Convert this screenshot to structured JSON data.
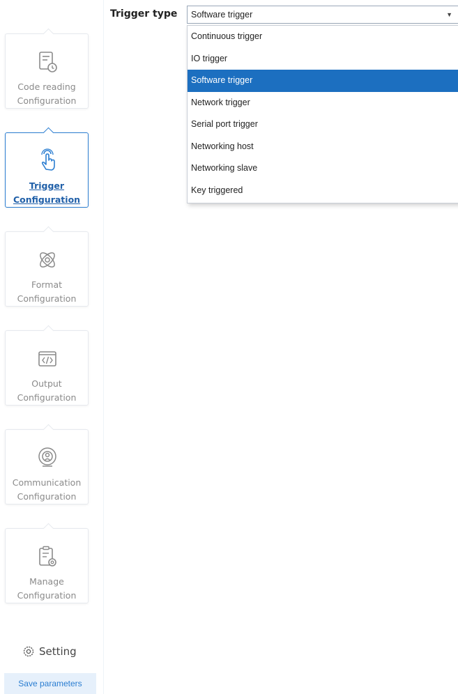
{
  "header": {
    "trigger_type_label": "Trigger type",
    "trigger_select_value": "Software trigger"
  },
  "dropdown": {
    "options": [
      "Continuous trigger",
      "IO trigger",
      "Software trigger",
      "Network trigger",
      "Serial port trigger",
      "Networking host",
      "Networking slave",
      "Key triggered"
    ],
    "selected": "Software trigger"
  },
  "sidebar": {
    "items": [
      {
        "line1": "Code reading",
        "line2": "Configuration",
        "icon": "code-reading-icon",
        "active": false
      },
      {
        "line1": "Trigger",
        "line2": "Configuration",
        "icon": "hand-tap-icon",
        "active": true
      },
      {
        "line1": "Format",
        "line2": "Configuration",
        "icon": "format-icon",
        "active": false
      },
      {
        "line1": "Output",
        "line2": "Configuration",
        "icon": "code-output-icon",
        "active": false
      },
      {
        "line1": "Communication",
        "line2": "Configuration",
        "icon": "communication-icon",
        "active": false
      },
      {
        "line1": "Manage",
        "line2": "Configuration",
        "icon": "manage-icon",
        "active": false
      }
    ],
    "setting_label": "Setting",
    "save_label": "Save parameters"
  },
  "colors": {
    "accent": "#1c6fc0",
    "active_border": "#2a7dd1",
    "inactive_text": "#8a8a8a",
    "save_bg": "#e6f0fb"
  }
}
